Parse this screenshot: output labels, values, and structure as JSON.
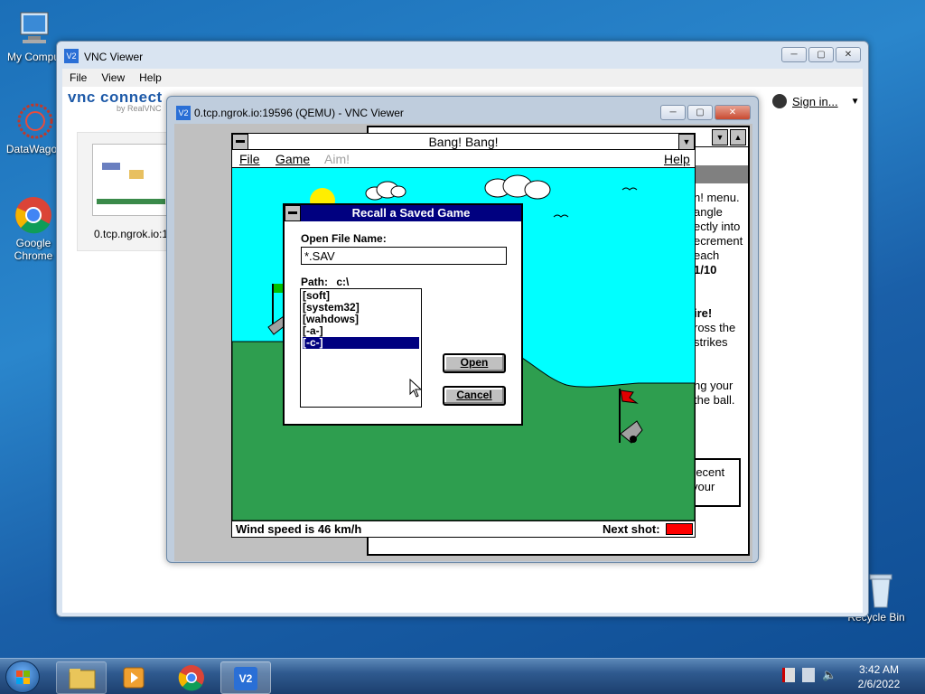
{
  "desktop": {
    "icons": [
      {
        "label": "My Compu"
      },
      {
        "label": "DataWagor"
      },
      {
        "label": "Google Chrome"
      },
      {
        "label": "Recycle Bin"
      }
    ]
  },
  "vnc_main": {
    "title": "VNC Viewer",
    "menu": [
      "File",
      "View",
      "Help"
    ],
    "logo": "vnc connect",
    "logo_sub": "by RealVNC",
    "sign_in": "Sign in...",
    "thumb_label": "0.tcp.ngrok.io:1"
  },
  "vnc_session": {
    "title": "0.tcp.ngrok.io:19596 (QEMU) - VNC Viewer"
  },
  "help_window_fragments": {
    "lines": [
      "n! menu.",
      "angle",
      "ectly into",
      "ecrement",
      "each",
      "1/10",
      "ire!",
      "ross the",
      "strikes",
      "ng your",
      "the ball.",
      "recent",
      "your"
    ]
  },
  "bang": {
    "title": "Bang! Bang!",
    "menu": {
      "file": "File",
      "game": "Game",
      "aim": "Aim!",
      "help": "Help"
    },
    "status_wind": "Wind speed is 46 km/h",
    "next_shot_label": "Next shot:",
    "next_shot_color": "#ff0000"
  },
  "dialog": {
    "title": "Recall a Saved Game",
    "open_label": "Open File Name:",
    "filename": "*.SAV",
    "path_label": "Path:",
    "path_value": "c:\\",
    "dirs": [
      "[soft]",
      "[system32]",
      "[wahdows]",
      "[-a-]",
      "[-c-]"
    ],
    "selected_index": 4,
    "open_button": "Open",
    "cancel_button": "Cancel"
  },
  "taskbar": {
    "time": "3:42 AM",
    "date": "2/6/2022"
  }
}
